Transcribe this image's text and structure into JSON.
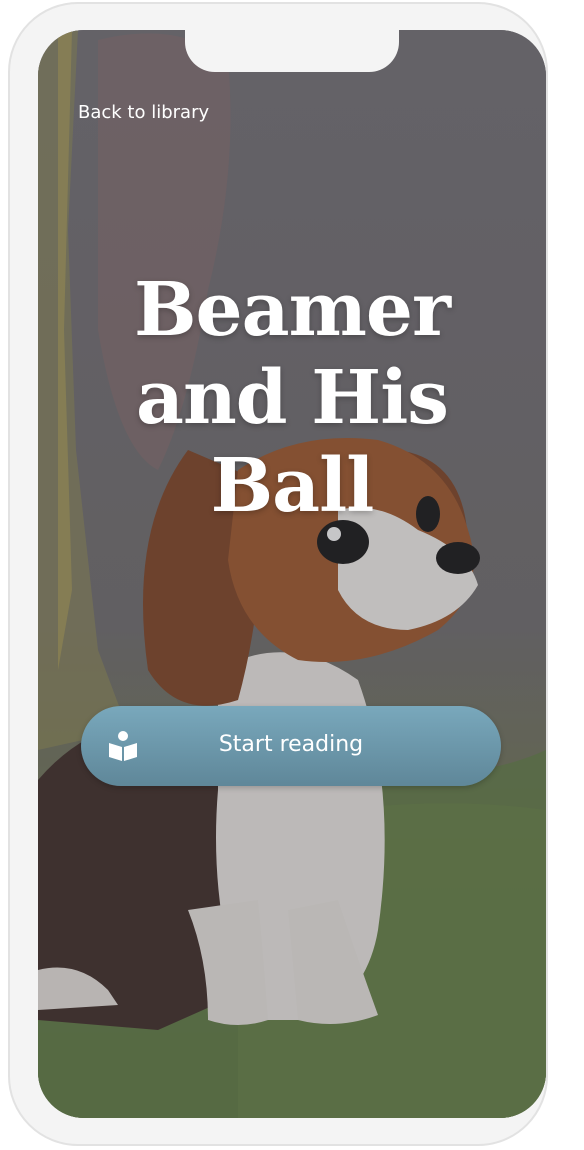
{
  "header": {
    "back_label": "Back to library"
  },
  "book": {
    "title": "Beamer and His Ball"
  },
  "actions": {
    "start_label": "Start reading",
    "start_icon": "open-book-reader-icon"
  },
  "colors": {
    "button": "#6f99ab",
    "overlay": "#5a5660",
    "grass": "#5f7a3f"
  }
}
